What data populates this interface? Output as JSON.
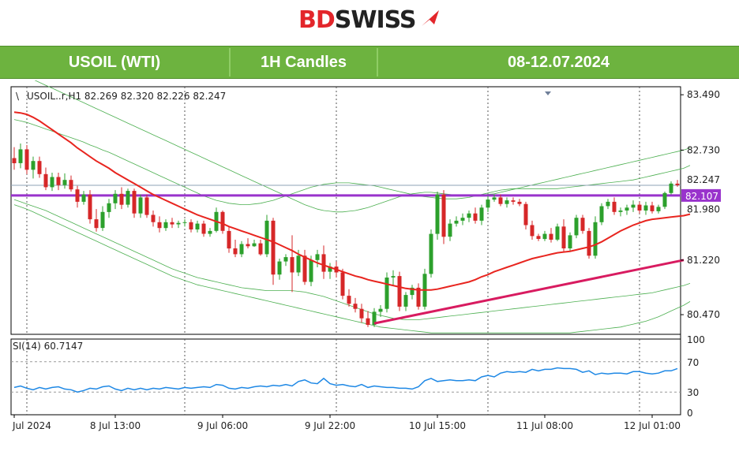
{
  "brand": {
    "name_left": "BD",
    "name_right": "SWISS",
    "colors": {
      "red": "#e3262b",
      "dark": "#222222"
    }
  },
  "header": {
    "symbol": "USOIL (WTI)",
    "timeframe": "1H Candles",
    "period": "08-12.07.2024",
    "color": "#6db33f"
  },
  "chart_data": {
    "type": "candlestick",
    "info_text": "USOIL..r,H1  82.269 82.320 82.226 82.247",
    "price_axis_ticks": [
      83.49,
      82.73,
      81.22,
      80.47
    ],
    "price_axis_labels": [
      "83.490",
      "82.730",
      "81.220",
      "80.470"
    ],
    "ylim": [
      80.2,
      83.6
    ],
    "current_price": {
      "value": 82.247,
      "label": "82.247"
    },
    "horizontal_level": {
      "value": 82.107,
      "label": "82.107",
      "color": "#9933cc"
    },
    "partial_label": "81.980",
    "time_labels": [
      {
        "index": 0,
        "label": "Jul 2024"
      },
      {
        "index": 16,
        "label": "8 Jul 13:00"
      },
      {
        "index": 33,
        "label": "9 Jul 06:00"
      },
      {
        "index": 50,
        "label": "9 Jul 22:00"
      },
      {
        "index": 67,
        "label": "10 Jul 15:00"
      },
      {
        "index": 84,
        "label": "11 Jul 08:00"
      },
      {
        "index": 101,
        "label": "12 Jul 01:00"
      }
    ],
    "vertical_grid_indices": [
      2,
      27,
      51,
      75,
      99
    ],
    "colors": {
      "bull": "#2ca02c",
      "bear": "#d62728",
      "ma": "#e8251f",
      "bands": "#4caf50",
      "trend": "#d81b60",
      "rsi": "#1e88e5"
    },
    "candles": [
      [
        82.62,
        82.77,
        82.46,
        82.55
      ],
      [
        82.55,
        82.82,
        82.48,
        82.74
      ],
      [
        82.74,
        82.8,
        82.4,
        82.46
      ],
      [
        82.46,
        82.64,
        82.34,
        82.58
      ],
      [
        82.58,
        82.64,
        82.35,
        82.4
      ],
      [
        82.4,
        82.49,
        82.18,
        82.22
      ],
      [
        82.22,
        82.42,
        82.17,
        82.36
      ],
      [
        82.36,
        82.42,
        82.18,
        82.25
      ],
      [
        82.25,
        82.41,
        82.2,
        82.32
      ],
      [
        82.32,
        82.38,
        82.16,
        82.19
      ],
      [
        82.19,
        82.24,
        81.94,
        82.02
      ],
      [
        82.02,
        82.17,
        81.98,
        82.12
      ],
      [
        82.12,
        82.18,
        81.72,
        81.78
      ],
      [
        81.78,
        81.92,
        81.61,
        81.66
      ],
      [
        81.66,
        81.96,
        81.62,
        81.88
      ],
      [
        81.88,
        82.06,
        81.8,
        82.0
      ],
      [
        82.0,
        82.18,
        81.92,
        82.13
      ],
      [
        82.13,
        82.22,
        81.92,
        81.98
      ],
      [
        81.98,
        82.2,
        81.94,
        82.17
      ],
      [
        82.17,
        82.2,
        81.8,
        81.86
      ],
      [
        81.86,
        82.12,
        81.8,
        82.08
      ],
      [
        82.08,
        82.12,
        81.8,
        81.84
      ],
      [
        81.84,
        81.9,
        81.68,
        81.74
      ],
      [
        81.74,
        81.82,
        81.6,
        81.66
      ],
      [
        81.66,
        81.78,
        81.62,
        81.74
      ],
      [
        81.74,
        81.8,
        81.66,
        81.71
      ],
      [
        81.71,
        81.76,
        81.66,
        81.73
      ],
      [
        81.73,
        81.78,
        81.68,
        81.74
      ],
      [
        81.74,
        81.78,
        81.6,
        81.64
      ],
      [
        81.64,
        81.76,
        81.6,
        81.72
      ],
      [
        81.72,
        81.76,
        81.54,
        81.58
      ],
      [
        81.58,
        81.66,
        81.54,
        81.62
      ],
      [
        81.62,
        81.94,
        81.6,
        81.88
      ],
      [
        81.88,
        81.9,
        81.58,
        81.62
      ],
      [
        81.62,
        81.68,
        81.32,
        81.38
      ],
      [
        81.38,
        81.5,
        81.26,
        81.3
      ],
      [
        81.3,
        81.48,
        81.26,
        81.44
      ],
      [
        81.44,
        81.52,
        81.38,
        81.41
      ],
      [
        81.41,
        81.5,
        81.4,
        81.45
      ],
      [
        81.45,
        81.5,
        81.28,
        81.3
      ],
      [
        81.3,
        81.84,
        81.26,
        81.76
      ],
      [
        81.76,
        81.8,
        80.88,
        81.02
      ],
      [
        81.02,
        81.24,
        80.95,
        81.2
      ],
      [
        81.2,
        81.3,
        81.14,
        81.26
      ],
      [
        81.26,
        81.56,
        80.78,
        81.05
      ],
      [
        81.05,
        81.36,
        81.0,
        81.28
      ],
      [
        81.28,
        81.36,
        80.88,
        80.92
      ],
      [
        80.92,
        81.28,
        80.86,
        81.22
      ],
      [
        81.22,
        81.36,
        81.12,
        81.3
      ],
      [
        81.3,
        81.42,
        80.96,
        81.06
      ],
      [
        81.06,
        81.18,
        80.96,
        81.13
      ],
      [
        81.13,
        81.2,
        80.98,
        81.05
      ],
      [
        81.05,
        81.1,
        80.68,
        80.73
      ],
      [
        80.73,
        80.82,
        80.58,
        80.62
      ],
      [
        80.62,
        80.7,
        80.5,
        80.55
      ],
      [
        80.55,
        80.62,
        80.36,
        80.42
      ],
      [
        80.42,
        80.52,
        80.3,
        80.33
      ],
      [
        80.33,
        80.56,
        80.3,
        80.51
      ],
      [
        80.51,
        80.6,
        80.44,
        80.55
      ],
      [
        80.55,
        81.05,
        80.5,
        80.98
      ],
      [
        80.98,
        81.08,
        80.86,
        81.0
      ],
      [
        81.0,
        81.06,
        80.52,
        80.58
      ],
      [
        80.58,
        80.78,
        80.52,
        80.74
      ],
      [
        80.74,
        80.88,
        80.68,
        80.84
      ],
      [
        80.84,
        80.9,
        80.54,
        80.58
      ],
      [
        80.58,
        81.1,
        80.54,
        81.03
      ],
      [
        81.03,
        81.64,
        80.98,
        81.58
      ],
      [
        81.58,
        82.16,
        81.5,
        82.12
      ],
      [
        82.12,
        82.18,
        81.44,
        81.54
      ],
      [
        81.54,
        81.78,
        81.48,
        81.72
      ],
      [
        81.72,
        81.82,
        81.68,
        81.76
      ],
      [
        81.76,
        81.86,
        81.7,
        81.8
      ],
      [
        81.8,
        81.9,
        81.74,
        81.86
      ],
      [
        81.86,
        81.94,
        81.72,
        81.76
      ],
      [
        81.76,
        81.98,
        81.7,
        81.94
      ],
      [
        81.94,
        82.1,
        81.88,
        82.05
      ],
      [
        82.05,
        82.12,
        82.02,
        82.08
      ],
      [
        82.08,
        82.12,
        81.96,
        81.99
      ],
      [
        81.99,
        82.08,
        81.94,
        82.04
      ],
      [
        82.04,
        82.08,
        81.98,
        82.02
      ],
      [
        82.02,
        82.06,
        81.96,
        81.99
      ],
      [
        81.99,
        82.02,
        81.64,
        81.7
      ],
      [
        81.7,
        81.76,
        81.5,
        81.55
      ],
      [
        81.55,
        81.58,
        81.48,
        81.51
      ],
      [
        81.51,
        81.62,
        81.48,
        81.58
      ],
      [
        81.58,
        81.66,
        81.46,
        81.5
      ],
      [
        81.5,
        81.72,
        81.48,
        81.68
      ],
      [
        81.68,
        81.78,
        81.34,
        81.38
      ],
      [
        81.38,
        81.6,
        81.34,
        81.56
      ],
      [
        81.56,
        81.84,
        81.52,
        81.8
      ],
      [
        81.8,
        81.84,
        81.58,
        81.62
      ],
      [
        81.62,
        81.66,
        81.24,
        81.28
      ],
      [
        81.28,
        81.82,
        81.24,
        81.74
      ],
      [
        81.74,
        82.0,
        81.7,
        81.96
      ],
      [
        81.96,
        82.06,
        81.92,
        82.02
      ],
      [
        82.02,
        82.08,
        81.84,
        81.88
      ],
      [
        81.88,
        81.94,
        81.82,
        81.9
      ],
      [
        81.9,
        81.98,
        81.84,
        81.94
      ],
      [
        81.94,
        82.04,
        81.88,
        81.98
      ],
      [
        81.98,
        82.02,
        81.86,
        81.9
      ],
      [
        81.9,
        82.02,
        81.84,
        81.97
      ],
      [
        81.97,
        82.02,
        81.86,
        81.89
      ],
      [
        81.89,
        81.98,
        81.86,
        81.95
      ],
      [
        81.95,
        82.16,
        81.92,
        82.14
      ],
      [
        82.14,
        82.3,
        82.12,
        82.27
      ],
      [
        82.269,
        82.32,
        82.226,
        82.247
      ]
    ],
    "ma_series": [
      83.25,
      83.24,
      83.22,
      83.18,
      83.13,
      83.07,
      83.01,
      82.95,
      82.89,
      82.83,
      82.76,
      82.7,
      82.64,
      82.58,
      82.53,
      82.48,
      82.42,
      82.37,
      82.32,
      82.27,
      82.22,
      82.17,
      82.12,
      82.08,
      82.04,
      82.0,
      81.96,
      81.92,
      81.88,
      81.84,
      81.81,
      81.78,
      81.75,
      81.72,
      81.68,
      81.65,
      81.62,
      81.59,
      81.56,
      81.53,
      81.5,
      81.47,
      81.43,
      81.39,
      81.35,
      81.3,
      81.26,
      81.22,
      81.18,
      81.15,
      81.12,
      81.09,
      81.06,
      81.03,
      81.0,
      80.98,
      80.95,
      80.93,
      80.91,
      80.89,
      80.87,
      80.85,
      80.83,
      80.82,
      80.81,
      80.81,
      80.81,
      80.82,
      80.84,
      80.86,
      80.88,
      80.9,
      80.92,
      80.95,
      80.99,
      81.02,
      81.06,
      81.09,
      81.12,
      81.15,
      81.18,
      81.21,
      81.24,
      81.26,
      81.28,
      81.3,
      81.32,
      81.33,
      81.34,
      81.36,
      81.38,
      81.4,
      81.43,
      81.47,
      81.52,
      81.57,
      81.62,
      81.66,
      81.7,
      81.73,
      81.76,
      81.78,
      81.79,
      81.8,
      81.81,
      81.82,
      81.83,
      81.85
    ],
    "upper_band": [
      83.15,
      83.13,
      83.11,
      83.08,
      83.05,
      83.02,
      82.99,
      82.96,
      82.93,
      82.9,
      82.87,
      82.84,
      82.8,
      82.77,
      82.73,
      82.7,
      82.66,
      82.62,
      82.58,
      82.54,
      82.5,
      82.46,
      82.42,
      82.38,
      82.34,
      82.3,
      82.26,
      82.22,
      82.18,
      82.14,
      82.1,
      82.07,
      82.04,
      82.02,
      82.0,
      81.99,
      81.98,
      81.98,
      81.99,
      82.0,
      82.02,
      82.04,
      82.07,
      82.1,
      82.13,
      82.16,
      82.19,
      82.22,
      82.24,
      82.26,
      82.27,
      82.28,
      82.28,
      82.28,
      82.27,
      82.26,
      82.25,
      82.24,
      82.22,
      82.2,
      82.18,
      82.16,
      82.14,
      82.12,
      82.1,
      82.09,
      82.08,
      82.07,
      82.06,
      82.06,
      82.06,
      82.07,
      82.08,
      82.1,
      82.12,
      82.14,
      82.16,
      82.18,
      82.19,
      82.2,
      82.2,
      82.2,
      82.2,
      82.2,
      82.2,
      82.2,
      82.2,
      82.21,
      82.22,
      82.23,
      82.24,
      82.25,
      82.26,
      82.27,
      82.28,
      82.29,
      82.3,
      82.31,
      82.32,
      82.34,
      82.36,
      82.38,
      82.4,
      82.42,
      82.44,
      82.46,
      82.48,
      82.52
    ],
    "lower_band": [
      82.05,
      82.02,
      81.99,
      81.96,
      81.93,
      81.9,
      81.86,
      81.82,
      81.78,
      81.74,
      81.7,
      81.66,
      81.62,
      81.58,
      81.54,
      81.5,
      81.46,
      81.42,
      81.38,
      81.34,
      81.3,
      81.26,
      81.22,
      81.18,
      81.14,
      81.1,
      81.07,
      81.04,
      81.01,
      80.98,
      80.96,
      80.94,
      80.92,
      80.9,
      80.88,
      80.86,
      80.84,
      80.83,
      80.82,
      80.81,
      80.8,
      80.8,
      80.8,
      80.8,
      80.8,
      80.79,
      80.78,
      80.76,
      80.74,
      80.72,
      80.69,
      80.66,
      80.63,
      80.6,
      80.57,
      80.54,
      80.51,
      80.48,
      80.46,
      80.44,
      80.42,
      80.41,
      80.4,
      80.4,
      80.4,
      80.41,
      80.42,
      80.43,
      80.44,
      80.45,
      80.46,
      80.47,
      80.48,
      80.49,
      80.5,
      80.51,
      80.52,
      80.53,
      80.54,
      80.55,
      80.56,
      80.57,
      80.58,
      80.59,
      80.6,
      80.61,
      80.62,
      80.63,
      80.64,
      80.65,
      80.66,
      80.67,
      80.68,
      80.69,
      80.7,
      80.71,
      80.72,
      80.73,
      80.74,
      80.75,
      80.76,
      80.77,
      80.79,
      80.81,
      80.83,
      80.85,
      80.87,
      80.9
    ],
    "far_upper_band": [
      83.82,
      83.78,
      83.74,
      83.7,
      83.66,
      83.62,
      83.58,
      83.54,
      83.5,
      83.46,
      83.42,
      83.38,
      83.34,
      83.3,
      83.26,
      83.22,
      83.18,
      83.14,
      83.1,
      83.06,
      83.02,
      82.98,
      82.94,
      82.9,
      82.86,
      82.82,
      82.78,
      82.74,
      82.7,
      82.66,
      82.62,
      82.58,
      82.54,
      82.5,
      82.46,
      82.42,
      82.38,
      82.34,
      82.3,
      82.26,
      82.22,
      82.18,
      82.14,
      82.1,
      82.06,
      82.02,
      81.98,
      81.95,
      81.92,
      81.9,
      81.89,
      81.88,
      81.88,
      81.89,
      81.9,
      81.92,
      81.94,
      81.97,
      82.0,
      82.03,
      82.06,
      82.09,
      82.11,
      82.13,
      82.14,
      82.15,
      82.15,
      82.14,
      82.13,
      82.12,
      82.11,
      82.1,
      82.1,
      82.1,
      82.11,
      82.12,
      82.13,
      82.15,
      82.17,
      82.19,
      82.21,
      82.23,
      82.25,
      82.27,
      82.29,
      82.31,
      82.33,
      82.35,
      82.37,
      82.39,
      82.41,
      82.43,
      82.45,
      82.47,
      82.49,
      82.51,
      82.53,
      82.55,
      82.57,
      82.59,
      82.61,
      82.63,
      82.65,
      82.67,
      82.69,
      82.71,
      82.73,
      82.76
    ],
    "far_lower_band": [
      81.98,
      81.95,
      81.92,
      81.88,
      81.84,
      81.8,
      81.76,
      81.72,
      81.68,
      81.64,
      81.6,
      81.56,
      81.52,
      81.48,
      81.44,
      81.4,
      81.36,
      81.32,
      81.28,
      81.24,
      81.2,
      81.16,
      81.12,
      81.08,
      81.04,
      81.0,
      80.97,
      80.94,
      80.91,
      80.88,
      80.86,
      80.84,
      80.82,
      80.8,
      80.78,
      80.76,
      80.74,
      80.72,
      80.7,
      80.68,
      80.66,
      80.64,
      80.62,
      80.6,
      80.58,
      80.56,
      80.54,
      80.52,
      80.5,
      80.48,
      80.46,
      80.44,
      80.42,
      80.4,
      80.38,
      80.36,
      80.34,
      80.32,
      80.3,
      80.29,
      80.28,
      80.27,
      80.26,
      80.25,
      80.24,
      80.23,
      80.22,
      80.22,
      80.22,
      80.22,
      80.22,
      80.22,
      80.22,
      80.22,
      80.22,
      80.22,
      80.22,
      80.22,
      80.22,
      80.22,
      80.22,
      80.22,
      80.22,
      80.22,
      80.22,
      80.22,
      80.22,
      80.22,
      80.22,
      80.23,
      80.24,
      80.25,
      80.26,
      80.27,
      80.28,
      80.29,
      80.3,
      80.32,
      80.34,
      80.36,
      80.38,
      80.41,
      80.44,
      80.48,
      80.52,
      80.56,
      80.6,
      80.65
    ],
    "trendline": {
      "start": {
        "index": 57,
        "value": 80.35
      },
      "end": {
        "index": 106,
        "value": 81.22
      }
    },
    "rsi": {
      "label": "SI(14) 60.7147",
      "ylim": [
        0,
        100
      ],
      "levels": [
        70,
        30
      ],
      "axis_labels": [
        "100",
        "70",
        "30",
        "0"
      ],
      "values": [
        36,
        38,
        35,
        33,
        36,
        34,
        36,
        37,
        34,
        33,
        30,
        32,
        35,
        34,
        37,
        38,
        34,
        32,
        35,
        33,
        35,
        33,
        35,
        34,
        36,
        35,
        34,
        36,
        35,
        36,
        37,
        36,
        40,
        39,
        35,
        34,
        36,
        35,
        37,
        38,
        37,
        39,
        38,
        40,
        38,
        44,
        46,
        42,
        41,
        48,
        41,
        39,
        40,
        38,
        37,
        40,
        36,
        38,
        37,
        36,
        36,
        35,
        35,
        34,
        37,
        45,
        48,
        44,
        45,
        46,
        45,
        45,
        46,
        45,
        50,
        52,
        50,
        55,
        57,
        56,
        57,
        56,
        60,
        58,
        60,
        60,
        62,
        61,
        61,
        60,
        56,
        58,
        53,
        55,
        54,
        55,
        55,
        54,
        57,
        57,
        55,
        54,
        55,
        58,
        58,
        61
      ]
    }
  }
}
